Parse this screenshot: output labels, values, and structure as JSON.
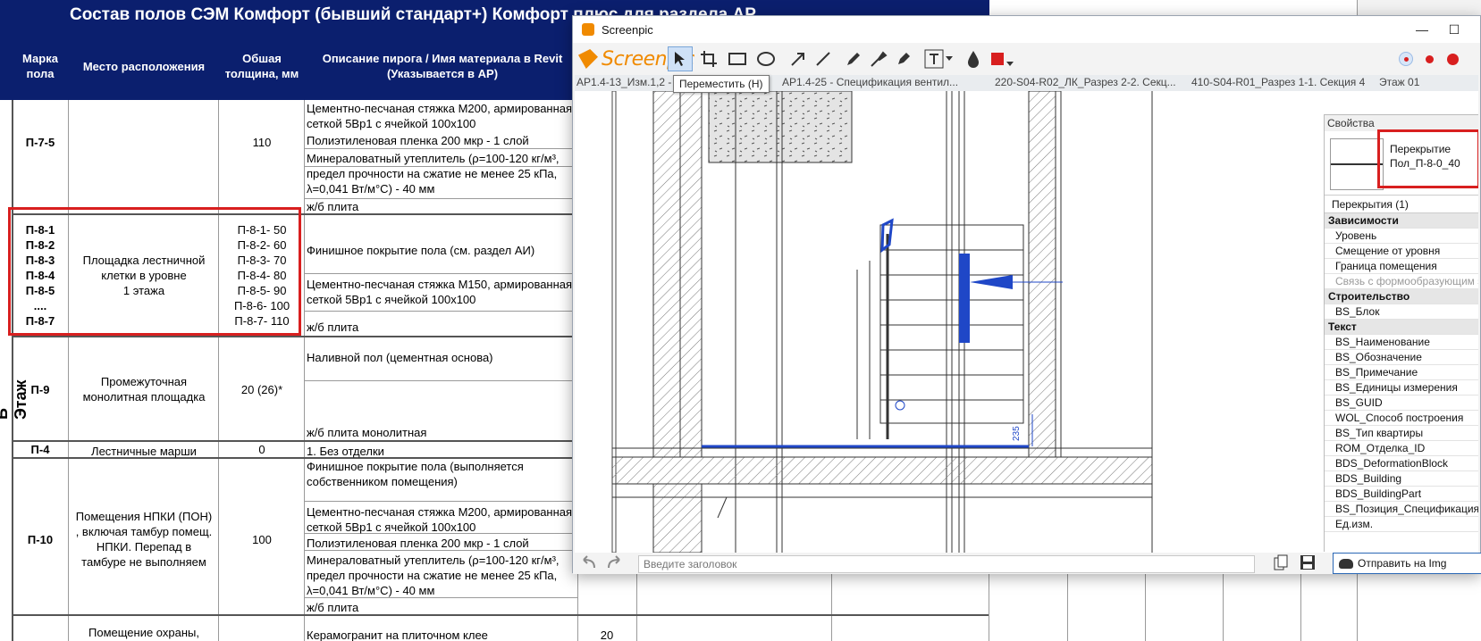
{
  "sheet": {
    "title": "Состав полов  СЭМ Комфорт (бывший стандарт+)  Комфорт плюс  для раздела АР",
    "side_label": "Б Этаж",
    "headers": {
      "mark": "Марка\nпола",
      "location": "Место расположения",
      "thickness": "Обшая\nтолщина, мм",
      "description": "Описание пирога / Имя материала в Revit\n(Указывается в АР)"
    },
    "rows": {
      "r1": {
        "mark": "П-7-5",
        "thickness": "110",
        "d1": "Цементно-песчаная стяжка М200, армированная\nсеткой 5Вр1 с ячейкой 100х100",
        "d2": "Полиэтиленовая пленка 200 мкр - 1 слой",
        "d3": "Минераловатный утеплитель (ρ=100-120 кг/м³,\nпредел прочности на сжатие не менее 25 кПа,\nλ=0,041 Вт/м°С) - 40 мм",
        "d4": "ж/б плита"
      },
      "r2": {
        "mark": "П-8-1\nП-8-2\nП-8-3\nП-8-4\nП-8-5\n....\nП-8-7",
        "location": "Площадка лестничной\nклетки в уровне\n1 этажа",
        "thickness": "П-8-1-  50\nП-8-2-  60\nП-8-3-  70\nП-8-4-  80\nП-8-5-  90\nП-8-6-  100\nП-8-7-  110",
        "d1": "Финишное покрытие пола (см. раздел АИ)",
        "d2": "Цементно-песчаная стяжка М150, армированная\nсеткой 5Вр1 с ячейкой 100х100",
        "d3": "ж/б плита"
      },
      "r3": {
        "mark": "П-9",
        "location": "Промежуточная\nмонолитная площадка",
        "thickness": "20 (26)*",
        "d1": "Наливной пол (цементная основа)",
        "d2": "ж/б плита монолитная"
      },
      "r4": {
        "mark": "П-4",
        "location": "Лестничные марши",
        "thickness": "0",
        "d1": "1. Без отделки"
      },
      "r5": {
        "mark": "П-10",
        "location": "Помещения НПКИ (ПОН)\n, включая тамбур помещ.\nНПКИ. Перепад в\nтамбуре не выполняем",
        "thickness": "100",
        "d1": "Финишное покрытие пола (выполняется\nсобственником помещения)",
        "d2": "Цементно-песчаная стяжка М200, армированная\nсеткой 5Вр1 с ячейкой 100х100",
        "d3": "Полиэтиленовая пленка 200 мкр - 1 слой",
        "d4": "Минераловатный утеплитель (ρ=100-120 кг/м³,\nпредел прочности на сжатие не менее 25 кПа,\nλ=0,041 Вт/м°С) - 40 мм",
        "d5": "ж/б плита"
      },
      "r6": {
        "location": "Помещение охраны,",
        "d1": "Керамогранит на плиточном клее",
        "extra": "20"
      }
    }
  },
  "window": {
    "title": "Screenpic",
    "minimize": "—",
    "maximize": "☐",
    "logo_text": "Screenpic",
    "tooltip": "Переместить (H)",
    "tabs": [
      "АР1.4-13_Изм.1,2 -",
      "АР1.4-25 - Спецификация вентил...",
      "220-S04-R02_ЛК_Разрез 2-2. Секц...",
      "410-S04-R01_Разрез 1-1. Секция 4",
      "Этаж 01"
    ],
    "dimension_label": "235",
    "colors": {
      "accent": "#f08a00",
      "selection": "#1f47c7",
      "record": "#d81f1f"
    },
    "input_placeholder": "Введите заголовок",
    "send_button": "Отправить на Img",
    "props": {
      "title": "Свойства",
      "preview_text": "Перекрытие\nПол_П-8-0_40",
      "count": "Перекрытия (1)",
      "groups": [
        {
          "label": "Зависимости"
        },
        {
          "label": "Уровень"
        },
        {
          "label": "Смещение от уровня"
        },
        {
          "label": "Граница помещения"
        },
        {
          "label": "Связь с формообразующим э"
        },
        {
          "label": "Строительство"
        },
        {
          "label": "BS_Блок"
        },
        {
          "label": "Текст"
        },
        {
          "label": "BS_Наименование"
        },
        {
          "label": "BS_Обозначение"
        },
        {
          "label": "BS_Примечание"
        },
        {
          "label": "BS_Единицы измерения"
        },
        {
          "label": "BS_GUID"
        },
        {
          "label": "WOL_Способ построения"
        },
        {
          "label": "BS_Тип квартиры"
        },
        {
          "label": "ROM_Отделка_ID"
        },
        {
          "label": "BDS_DeformationBlock"
        },
        {
          "label": "BDS_Building"
        },
        {
          "label": "BDS_BuildingPart"
        },
        {
          "label": "BS_Позиция_Спецификация"
        },
        {
          "label": "Ед.изм."
        }
      ]
    }
  }
}
